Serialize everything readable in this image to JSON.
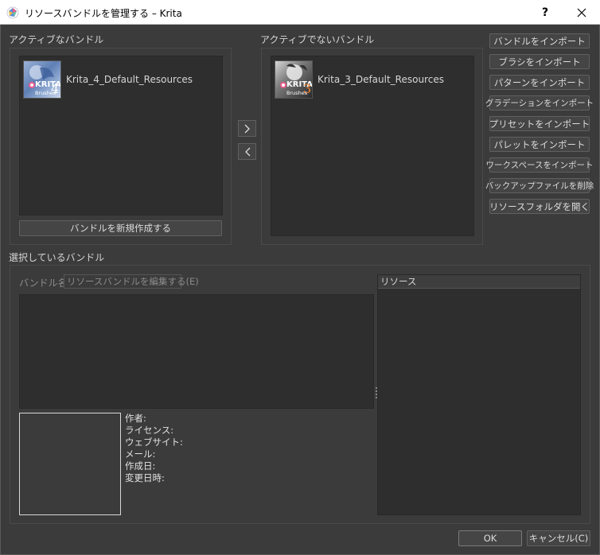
{
  "window": {
    "title": "リソースバンドルを管理する – Krita",
    "help_label": "?"
  },
  "active_bundles": {
    "label": "アクティブなバンドル",
    "items": [
      {
        "name": "Krita_4_Default_Resources",
        "thumb_text": "KRITA",
        "thumb_sub": "Brushes",
        "thumb_num": "4"
      }
    ],
    "create_button": "バンドルを新規作成する"
  },
  "inactive_bundles": {
    "label": "アクティブでないバンドル",
    "items": [
      {
        "name": "Krita_3_Default_Resources",
        "thumb_text": "KRITA",
        "thumb_sub": "Brushes",
        "thumb_num": "3"
      }
    ]
  },
  "transfer": {
    "activate_icon": "chevron-right-icon",
    "deactivate_icon": "chevron-left-icon"
  },
  "side_buttons": [
    "バンドルをインポート",
    "ブラシをインポート",
    "パターンをインポート",
    "グラデーションをインポート",
    "プリセットをインポート",
    "パレットをインポート",
    "ワークスペースをインポート",
    "バックアップファイルを削除",
    "リソースフォルダを開く"
  ],
  "selected": {
    "label": "選択しているバンドル",
    "name_label": "バンドル名",
    "edit_button": "リソースバンドルを編集する(E)",
    "meta": {
      "author": "作者:",
      "license": "ライセンス:",
      "website": "ウェブサイト:",
      "email": "メール:",
      "created": "作成日:",
      "updated": "変更日時:"
    },
    "resources_header": "リソース"
  },
  "footer": {
    "ok": "OK",
    "cancel": "キャンセル(C)"
  },
  "colors": {
    "background": "#3b3b3b",
    "list_background": "#2e2e2e",
    "text": "#d6d6d6"
  }
}
